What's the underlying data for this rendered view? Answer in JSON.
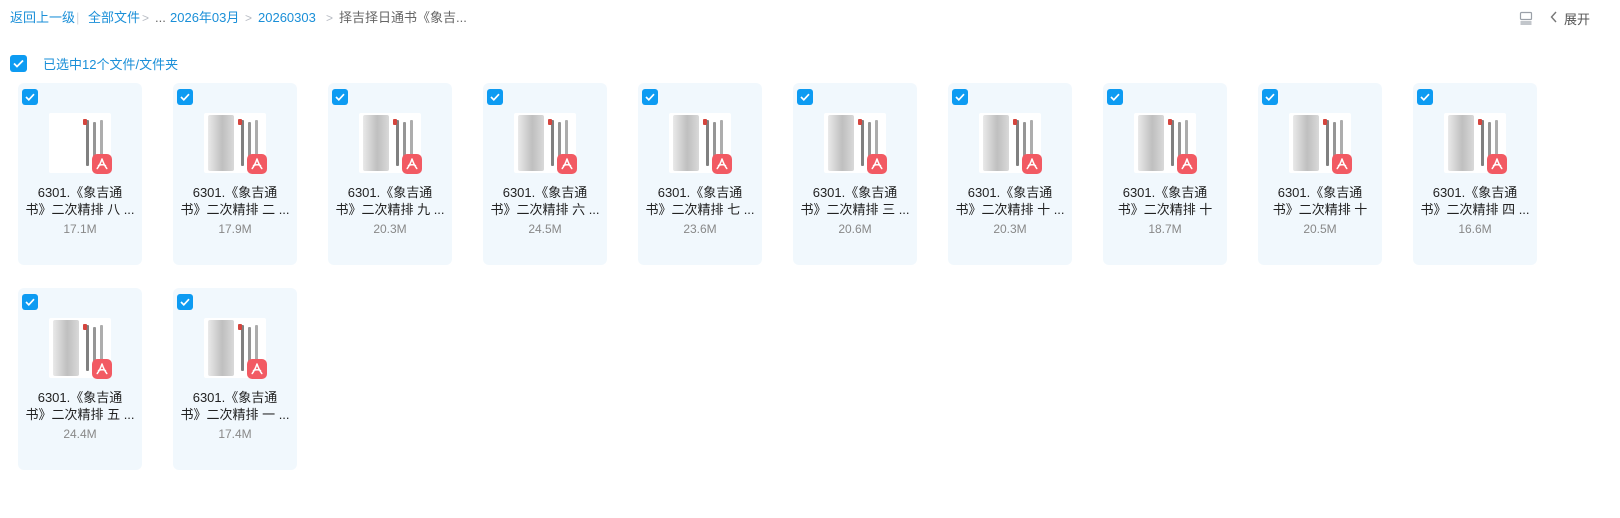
{
  "breadcrumb": {
    "back": "返回上一级",
    "all_files": "全部文件",
    "ellipsis": "...",
    "month": "2026年03月",
    "date": "20260303",
    "current": "择吉择日通书《象吉..."
  },
  "toolbar": {
    "expand_label": "展开"
  },
  "selection": {
    "text": "已选中12个文件/文件夹"
  },
  "files": [
    {
      "line1": "6301.《象吉通",
      "line2": "书》二次精排 八 ...",
      "size": "17.1M",
      "thumb": "plain"
    },
    {
      "line1": "6301.《象吉通",
      "line2": "书》二次精排 二 ...",
      "size": "17.9M",
      "thumb": "shaded"
    },
    {
      "line1": "6301.《象吉通",
      "line2": "书》二次精排 九 ...",
      "size": "20.3M",
      "thumb": "shaded"
    },
    {
      "line1": "6301.《象吉通",
      "line2": "书》二次精排 六 ...",
      "size": "24.5M",
      "thumb": "shaded"
    },
    {
      "line1": "6301.《象吉通",
      "line2": "书》二次精排 七 ...",
      "size": "23.6M",
      "thumb": "shaded"
    },
    {
      "line1": "6301.《象吉通",
      "line2": "书》二次精排 三 ...",
      "size": "20.6M",
      "thumb": "shaded"
    },
    {
      "line1": "6301.《象吉通",
      "line2": "书》二次精排 十 ...",
      "size": "20.3M",
      "thumb": "shaded"
    },
    {
      "line1": "6301.《象吉通",
      "line2": "书》二次精排 十",
      "size": "18.7M",
      "thumb": "shaded"
    },
    {
      "line1": "6301.《象吉通",
      "line2": "书》二次精排 十",
      "size": "20.5M",
      "thumb": "shaded"
    },
    {
      "line1": "6301.《象吉通",
      "line2": "书》二次精排 四 ...",
      "size": "16.6M",
      "thumb": "shaded"
    },
    {
      "line1": "6301.《象吉通",
      "line2": "书》二次精排 五 ...",
      "size": "24.4M",
      "thumb": "shaded"
    },
    {
      "line1": "6301.《象吉通",
      "line2": "书》二次精排 一 ...",
      "size": "17.4M",
      "thumb": "shaded"
    }
  ],
  "colors": {
    "accent": "#0d9bf2",
    "link": "#1a8fd8",
    "card_bg": "#f1f8fd",
    "pdf_badge": "#f25a63"
  },
  "icons": {
    "checkbox": "checkbox-checked-icon",
    "pdf": "pdf-icon",
    "view": "list-view-icon",
    "collapse": "chevron-left-icon"
  }
}
